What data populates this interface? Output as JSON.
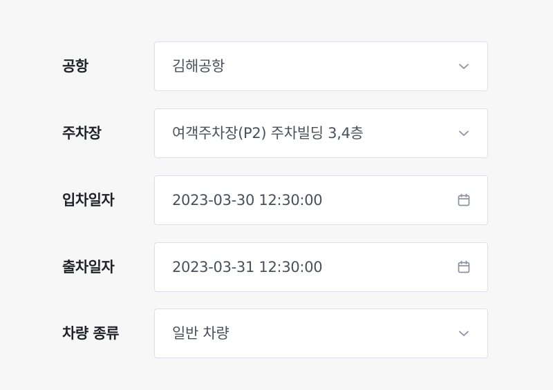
{
  "form": {
    "airport": {
      "label": "공항",
      "value": "김해공항",
      "icon": "chevron-down-icon"
    },
    "parking_lot": {
      "label": "주차장",
      "value": "여객주차장(P2) 주차빌딩 3,4층",
      "icon": "chevron-down-icon"
    },
    "entry_date": {
      "label": "입차일자",
      "value": "2023-03-30 12:30:00",
      "icon": "calendar-icon"
    },
    "exit_date": {
      "label": "출차일자",
      "value": "2023-03-31 12:30:00",
      "icon": "calendar-icon"
    },
    "vehicle_type": {
      "label": "차량 종류",
      "value": "일반 차량",
      "icon": "chevron-down-icon"
    }
  },
  "colors": {
    "background": "#f7f7f7",
    "field_background": "#ffffff",
    "field_border": "#dcdfe5",
    "label_text": "#202228",
    "value_text": "#4a4f58",
    "icon": "#8a909c"
  }
}
